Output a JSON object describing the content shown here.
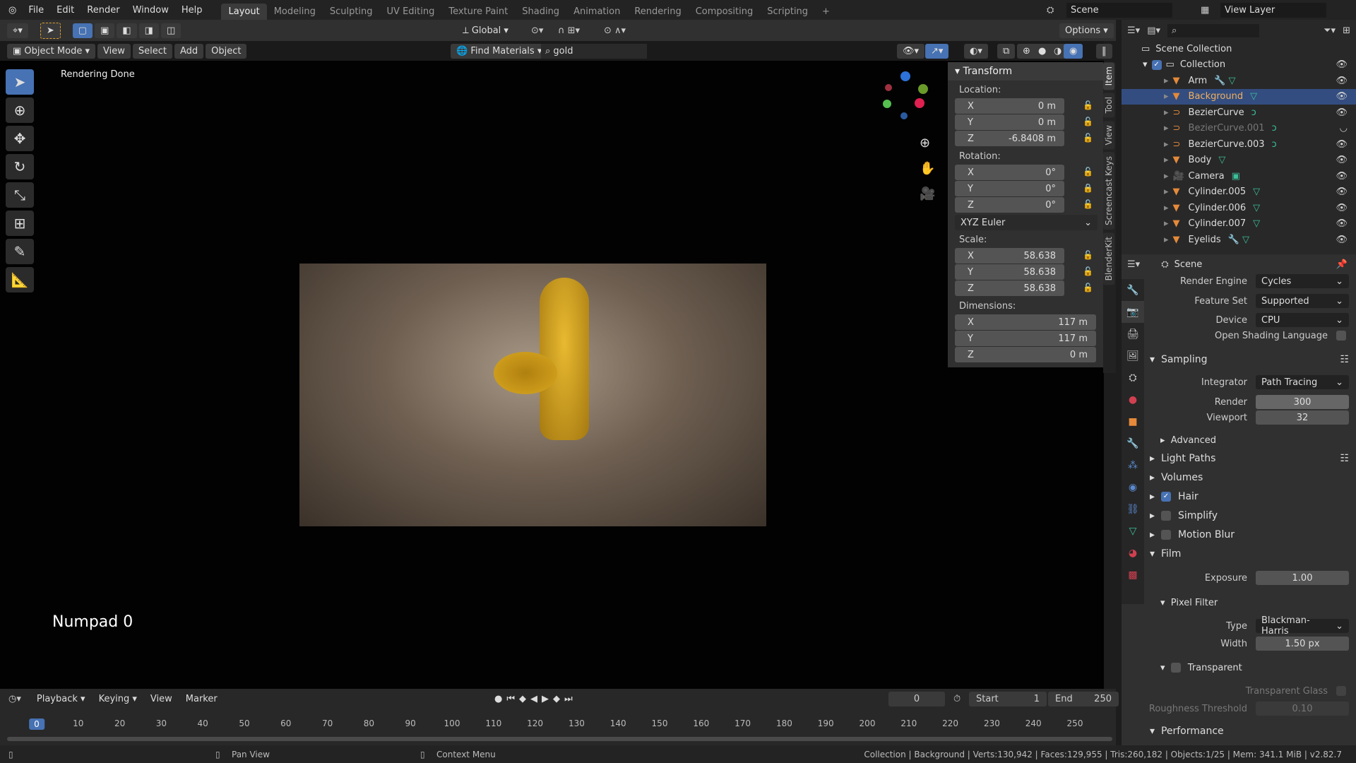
{
  "menu": [
    "File",
    "Edit",
    "Render",
    "Window",
    "Help"
  ],
  "workspaces": [
    "Layout",
    "Modeling",
    "Sculpting",
    "UV Editing",
    "Texture Paint",
    "Shading",
    "Animation",
    "Rendering",
    "Compositing",
    "Scripting"
  ],
  "scene": "Scene",
  "view_layer": "View Layer",
  "toolheader": {
    "orientation": "Global",
    "options": "Options"
  },
  "viewport_header": {
    "mode": "Object Mode",
    "items": [
      "View",
      "Select",
      "Add",
      "Object"
    ],
    "find": "Find Materials",
    "search": "gold"
  },
  "viewport": {
    "status": "Rendering Done",
    "keypress": "Numpad 0"
  },
  "transform": {
    "title": "Transform",
    "location_label": "Location:",
    "location": [
      {
        "axis": "X",
        "value": "0 m"
      },
      {
        "axis": "Y",
        "value": "0 m"
      },
      {
        "axis": "Z",
        "value": "-6.8408 m"
      }
    ],
    "rotation_label": "Rotation:",
    "rotation": [
      {
        "axis": "X",
        "value": "0°"
      },
      {
        "axis": "Y",
        "value": "0°"
      },
      {
        "axis": "Z",
        "value": "0°"
      }
    ],
    "rotation_mode": "XYZ Euler",
    "scale_label": "Scale:",
    "scale": [
      {
        "axis": "X",
        "value": "58.638"
      },
      {
        "axis": "Y",
        "value": "58.638"
      },
      {
        "axis": "Z",
        "value": "58.638"
      }
    ],
    "dimensions_label": "Dimensions:",
    "dimensions": [
      {
        "axis": "X",
        "value": "117 m"
      },
      {
        "axis": "Y",
        "value": "117 m"
      },
      {
        "axis": "Z",
        "value": "0 m"
      }
    ]
  },
  "side_tabs": [
    "Item",
    "Tool",
    "View",
    "Screencast Keys",
    "BlenderKit"
  ],
  "outliner": {
    "root": "Scene Collection",
    "collection": "Collection",
    "items": [
      "Arm",
      "Background",
      "BezierCurve",
      "BezierCurve.001",
      "BezierCurve.003",
      "Body",
      "Camera",
      "Cylinder.005",
      "Cylinder.006",
      "Cylinder.007",
      "Eyelids"
    ],
    "selected": "Background"
  },
  "properties": {
    "context": "Scene",
    "render_engine_label": "Render Engine",
    "render_engine": "Cycles",
    "feature_set_label": "Feature Set",
    "feature_set": "Supported",
    "device_label": "Device",
    "device": "CPU",
    "osl": "Open Shading Language",
    "sampling": "Sampling",
    "integrator_label": "Integrator",
    "integrator": "Path Tracing",
    "render_label": "Render",
    "render_samples": "300",
    "viewport_label": "Viewport",
    "viewport_samples": "32",
    "advanced": "Advanced",
    "light_paths": "Light Paths",
    "volumes": "Volumes",
    "hair": "Hair",
    "simplify": "Simplify",
    "motion_blur": "Motion Blur",
    "film": "Film",
    "exposure_label": "Exposure",
    "exposure": "1.00",
    "pixel_filter": "Pixel Filter",
    "type_label": "Type",
    "type": "Blackman-Harris",
    "width_label": "Width",
    "width": "1.50 px",
    "transparent": "Transparent",
    "transparent_glass": "Transparent Glass",
    "roughness_label": "Roughness Threshold",
    "roughness": "0.10",
    "performance": "Performance"
  },
  "timeline": {
    "menus": [
      "Playback",
      "Keying",
      "View",
      "Marker"
    ],
    "current": "0",
    "start_label": "Start",
    "start": "1",
    "end_label": "End",
    "end": "250",
    "ticks": [
      "0",
      "10",
      "20",
      "30",
      "40",
      "50",
      "60",
      "70",
      "80",
      "90",
      "100",
      "110",
      "120",
      "130",
      "140",
      "150",
      "160",
      "170",
      "180",
      "190",
      "200",
      "210",
      "220",
      "230",
      "240",
      "250"
    ]
  },
  "statusbar": {
    "pan": "Pan View",
    "context": "Context Menu",
    "info": "Collection | Background | Verts:130,942 | Faces:129,955 | Tris:260,182 | Objects:1/25 | Mem: 341.1 MiB | v2.82.7"
  },
  "colors": {
    "accent": "#4772b3",
    "selected_row": "#334d80",
    "object_icon": "#e58a3a",
    "data_icon": "#3cbf9a"
  }
}
